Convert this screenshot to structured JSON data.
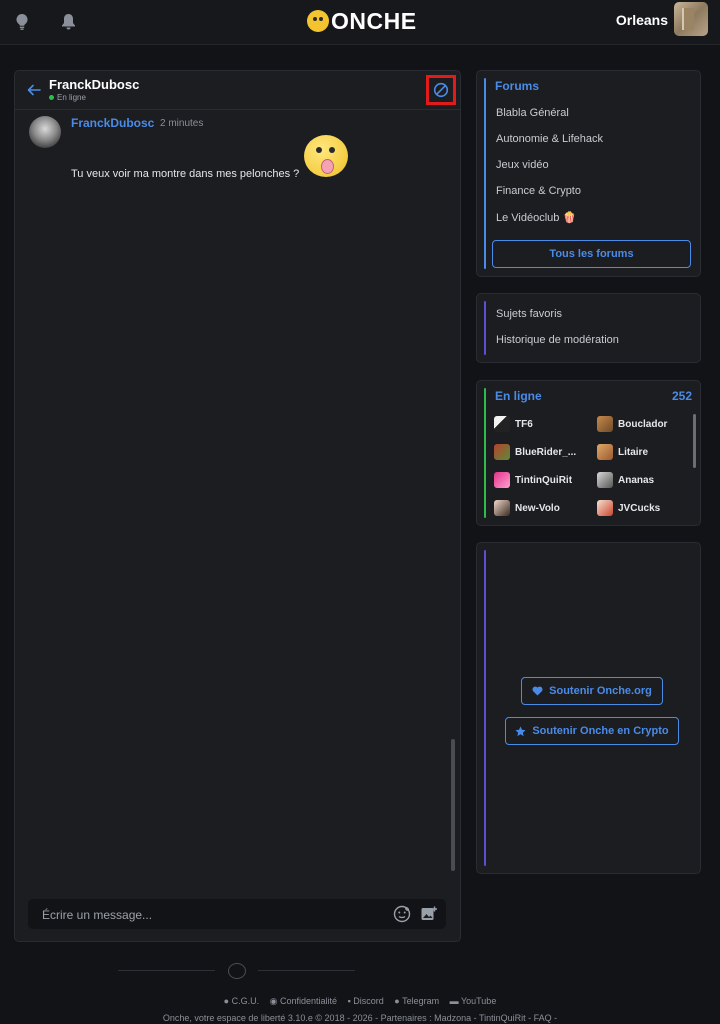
{
  "header": {
    "logo_text": "ONCHE",
    "username": "Orleans"
  },
  "chat": {
    "contact_name": "FranckDubosc",
    "status": "En ligne",
    "messages": [
      {
        "author": "FranckDubosc",
        "time": "2 minutes",
        "text": "Tu veux voir ma montre dans mes pelonches ?"
      }
    ],
    "composer_placeholder": "Écrire un message..."
  },
  "forums": {
    "title": "Forums",
    "items": [
      "Blabla Général",
      "Autonomie & Lifehack",
      "Jeux vidéo",
      "Finance & Crypto",
      "Le Vidéoclub 🍿"
    ],
    "all_button": "Tous les forums"
  },
  "extras": {
    "items": [
      "Sujets favoris",
      "Historique de modération"
    ]
  },
  "online": {
    "title": "En ligne",
    "count": "252",
    "users": [
      "TF6",
      "Bouclador",
      "BlueRider_...",
      "Litaire",
      "TintinQuiRit",
      "Ananas",
      "New-Volo",
      "JVCucks"
    ]
  },
  "support": {
    "button_org": "Soutenir Onche.org",
    "button_crypto": "Soutenir Onche en Crypto"
  },
  "footer": {
    "links": [
      "C.G.U.",
      "Confidentialité",
      "Discord",
      "Telegram",
      "YouTube"
    ],
    "copyright": "Onche, votre espace de liberté 3.10.e © 2018 - 2026 - Partenaires : Madzona  - TintinQuiRit  - FAQ  -"
  },
  "colors": {
    "accent": "#4a8be8",
    "background": "#121316",
    "card": "#1c1d21",
    "online_dot": "#2ebd4a",
    "highlight_box": "#e21a1a",
    "forums_bar": "#4a8be8",
    "extras_bar": "#5b4fd6",
    "online_bar": "#2ebd4a",
    "support_bar": "#5b4fd6"
  }
}
